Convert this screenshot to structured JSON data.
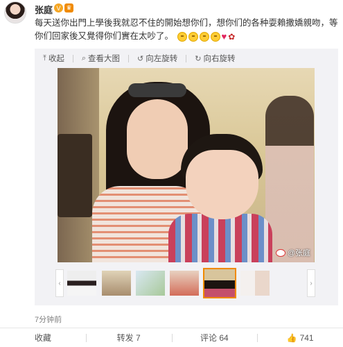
{
  "user": {
    "name": "张庭",
    "verified_icon": "v-badge-icon",
    "member_icon": "crown-icon"
  },
  "post": {
    "text": "每天送你出門上學後我就忍不住的開始想你们，想你们的各种耍賴撒嬌親吻，等你们回家後又覺得你们實在太吵了。",
    "emojis": [
      "laugh-emoji",
      "shy-emoji",
      "kiss-emoji",
      "smile-emoji",
      "heart-emoji",
      "rose-emoji"
    ]
  },
  "media_toolbar": {
    "collapse": "收起",
    "view_large": "查看大图",
    "rotate_left": "向左旋转",
    "rotate_right": "向右旋转"
  },
  "photo": {
    "watermark": "@张庭"
  },
  "thumbnails": {
    "count": 6,
    "active_index": 4
  },
  "timestamp": "7分钟前",
  "actions": {
    "favorite": "收藏",
    "repost": "转发 7",
    "comment": "评论 64",
    "like": "741"
  }
}
